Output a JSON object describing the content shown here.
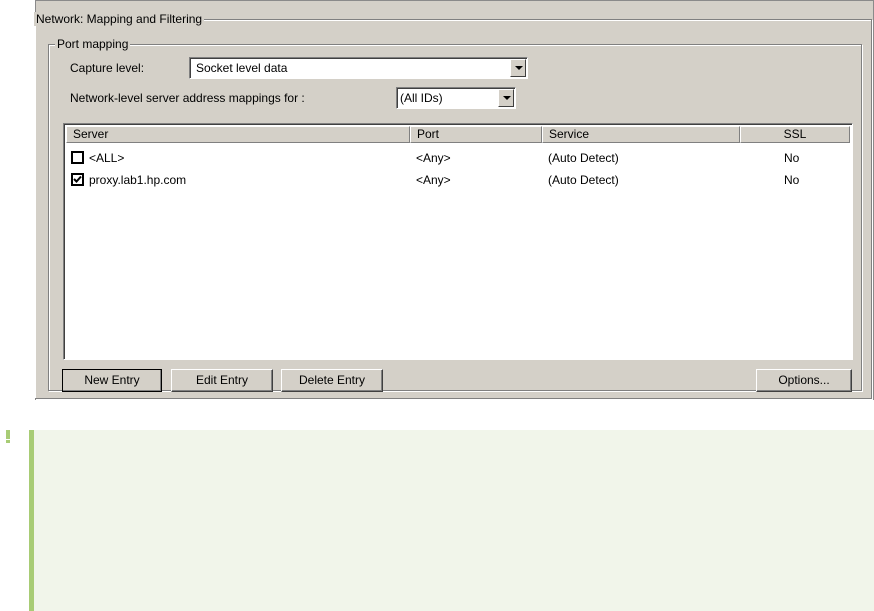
{
  "dialog": {
    "section_title": "Network: Mapping and Filtering",
    "port_mapping_title": "Port mapping",
    "capture_level": {
      "label": "Capture level:",
      "value": "Socket level data"
    },
    "address_mappings": {
      "label": "Network-level server address mappings for :",
      "value": "(All IDs)"
    },
    "table": {
      "columns": [
        "Server",
        "Port",
        "Service",
        "SSL"
      ],
      "rows": [
        {
          "checked": false,
          "server": "<ALL>",
          "port": "<Any>",
          "service": "(Auto Detect)",
          "ssl": "No"
        },
        {
          "checked": true,
          "server": "proxy.lab1.hp.com",
          "port": "<Any>",
          "service": "(Auto Detect)",
          "ssl": "No"
        }
      ]
    },
    "buttons": {
      "new_entry": "New Entry",
      "edit_entry": "Edit Entry",
      "delete_entry": "Delete Entry",
      "options": "Options..."
    }
  },
  "note": {
    "icon": "exclamation-icon",
    "accent_color": "#a8cc75",
    "background_color": "#f1f5ea"
  }
}
